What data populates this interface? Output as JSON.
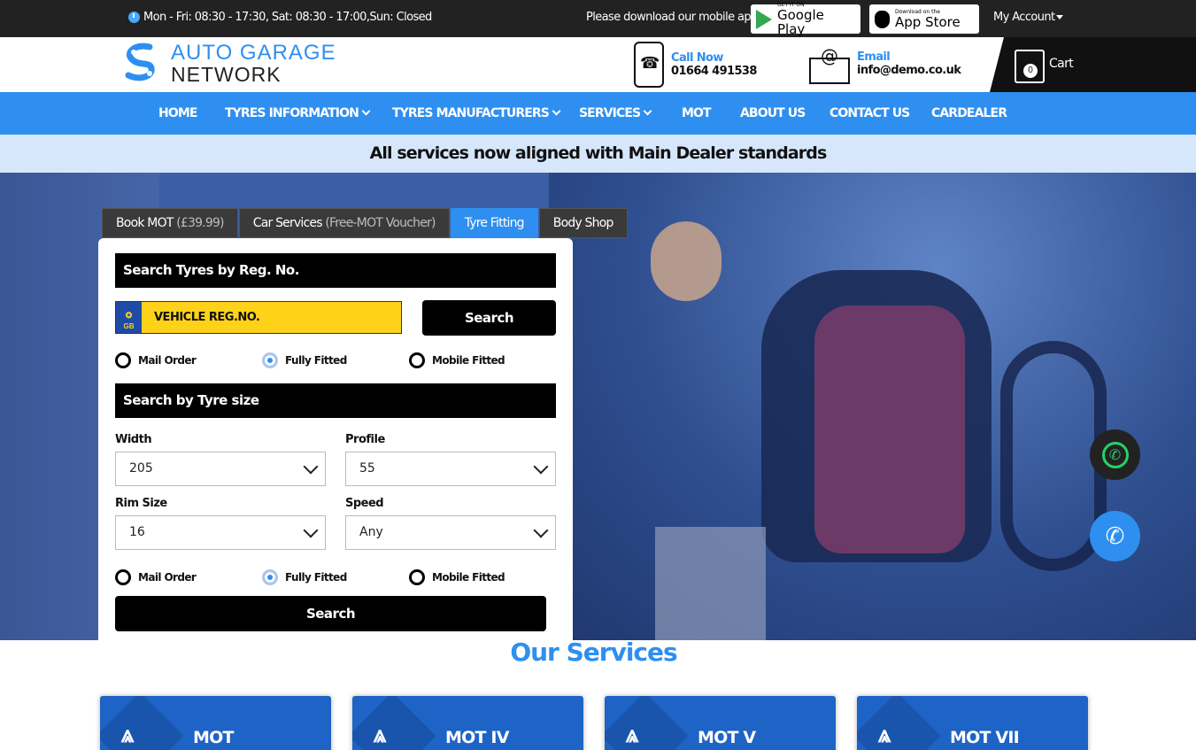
{
  "topbar": {
    "hours": "Mon - Fri: 08:30 - 17:30, Sat: 08:30 - 17:00,Sun: Closed",
    "app_text": "Please download our mobile app",
    "google_play": {
      "small": "GET IT ON",
      "big": "Google Play"
    },
    "app_store": {
      "small": "Download on the",
      "big": "App Store"
    },
    "account": "My Account"
  },
  "header": {
    "logo_line1": "AUTO GARAGE",
    "logo_line2": "NETWORK",
    "call_label": "Call Now",
    "call_value": "01664 491538",
    "email_label": "Email",
    "email_value": "info@demo.co.uk",
    "cart_count": "0",
    "cart_label": "Cart"
  },
  "nav": {
    "items": [
      {
        "label": "HOME"
      },
      {
        "label": "TYRES INFORMATION"
      },
      {
        "label": "TYRES MANUFACTURERS"
      },
      {
        "label": "SERVICES"
      },
      {
        "label": "MOT"
      },
      {
        "label": "ABOUT US"
      },
      {
        "label": "CONTACT US"
      },
      {
        "label": "CARDEALER"
      }
    ]
  },
  "announcement": "All services now aligned with Main Dealer standards",
  "tabs": [
    {
      "label": "Book MOT",
      "muted": "(£39.99)"
    },
    {
      "label": "Car Services",
      "muted": "(Free-MOT Voucher)"
    },
    {
      "label": "Tyre Fitting",
      "muted": ""
    },
    {
      "label": "Body Shop",
      "muted": ""
    }
  ],
  "reg_search": {
    "title": "Search Tyres by Reg. No.",
    "flag": "GB",
    "placeholder": "VEHICLE REG.NO.",
    "button": "Search",
    "options": [
      "Mail Order",
      "Fully Fitted",
      "Mobile Fitted"
    ],
    "selected": "Fully Fitted"
  },
  "size_search": {
    "title": "Search by Tyre size",
    "width_label": "Width",
    "width_value": "205",
    "profile_label": "Profile",
    "profile_value": "55",
    "rim_label": "Rim Size",
    "rim_value": "16",
    "speed_label": "Speed",
    "speed_value": "Any",
    "options": [
      "Mail Order",
      "Fully Fitted",
      "Mobile Fitted"
    ],
    "selected": "Fully Fitted",
    "button": "Search"
  },
  "services": {
    "title": "Our Services",
    "cards": [
      {
        "label": "MOT"
      },
      {
        "label": "MOT IV"
      },
      {
        "label": "MOT V"
      },
      {
        "label": "MOT VII"
      }
    ]
  },
  "colors": {
    "accent": "#2e8ff0",
    "dark": "#222222",
    "reg_yellow": "#ffd21a",
    "service_card": "#1e63c6"
  }
}
